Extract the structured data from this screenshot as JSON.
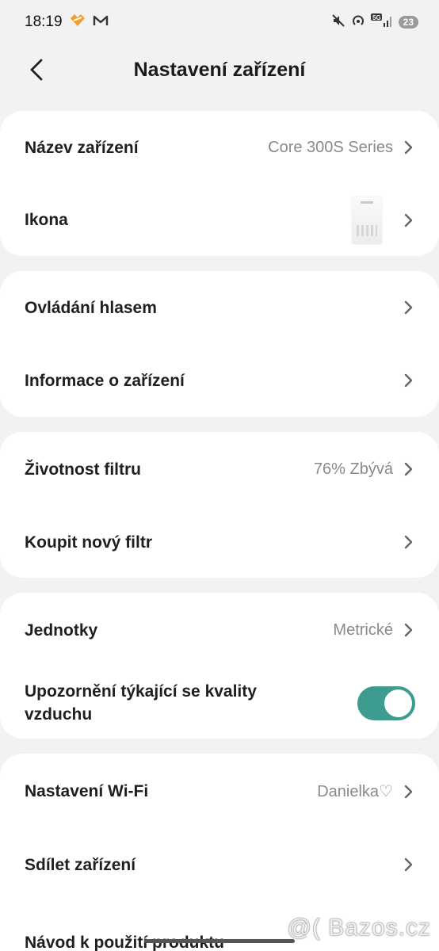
{
  "status_bar": {
    "time": "18:19",
    "battery": "23",
    "network": "5G"
  },
  "header": {
    "title": "Nastavení zařízení"
  },
  "sections": {
    "device": {
      "name_label": "Název zařízení",
      "name_value": "Core 300S Series",
      "icon_label": "Ikona"
    },
    "control": {
      "voice_label": "Ovládání hlasem",
      "info_label": "Informace o zařízení"
    },
    "filter": {
      "life_label": "Životnost filtru",
      "life_value": "76% Zbývá",
      "life_percent": 76,
      "buy_label": "Koupit nový filtr"
    },
    "prefs": {
      "units_label": "Jednotky",
      "units_value": "Metrické",
      "air_alert_label": "Upozornění týkající se kvality vzduchu",
      "air_alert_enabled": true
    },
    "network": {
      "wifi_label": "Nastavení Wi-Fi",
      "wifi_value": "Danielka♡",
      "share_label": "Sdílet zařízení",
      "cut_label": "Návod k použití produktu"
    }
  },
  "watermark": "@( Bazos.cz",
  "colors": {
    "background": "#f2f2f2",
    "card": "#ffffff",
    "toggle_on": "#3e9b8f",
    "brand_orange": "#f0a030"
  }
}
